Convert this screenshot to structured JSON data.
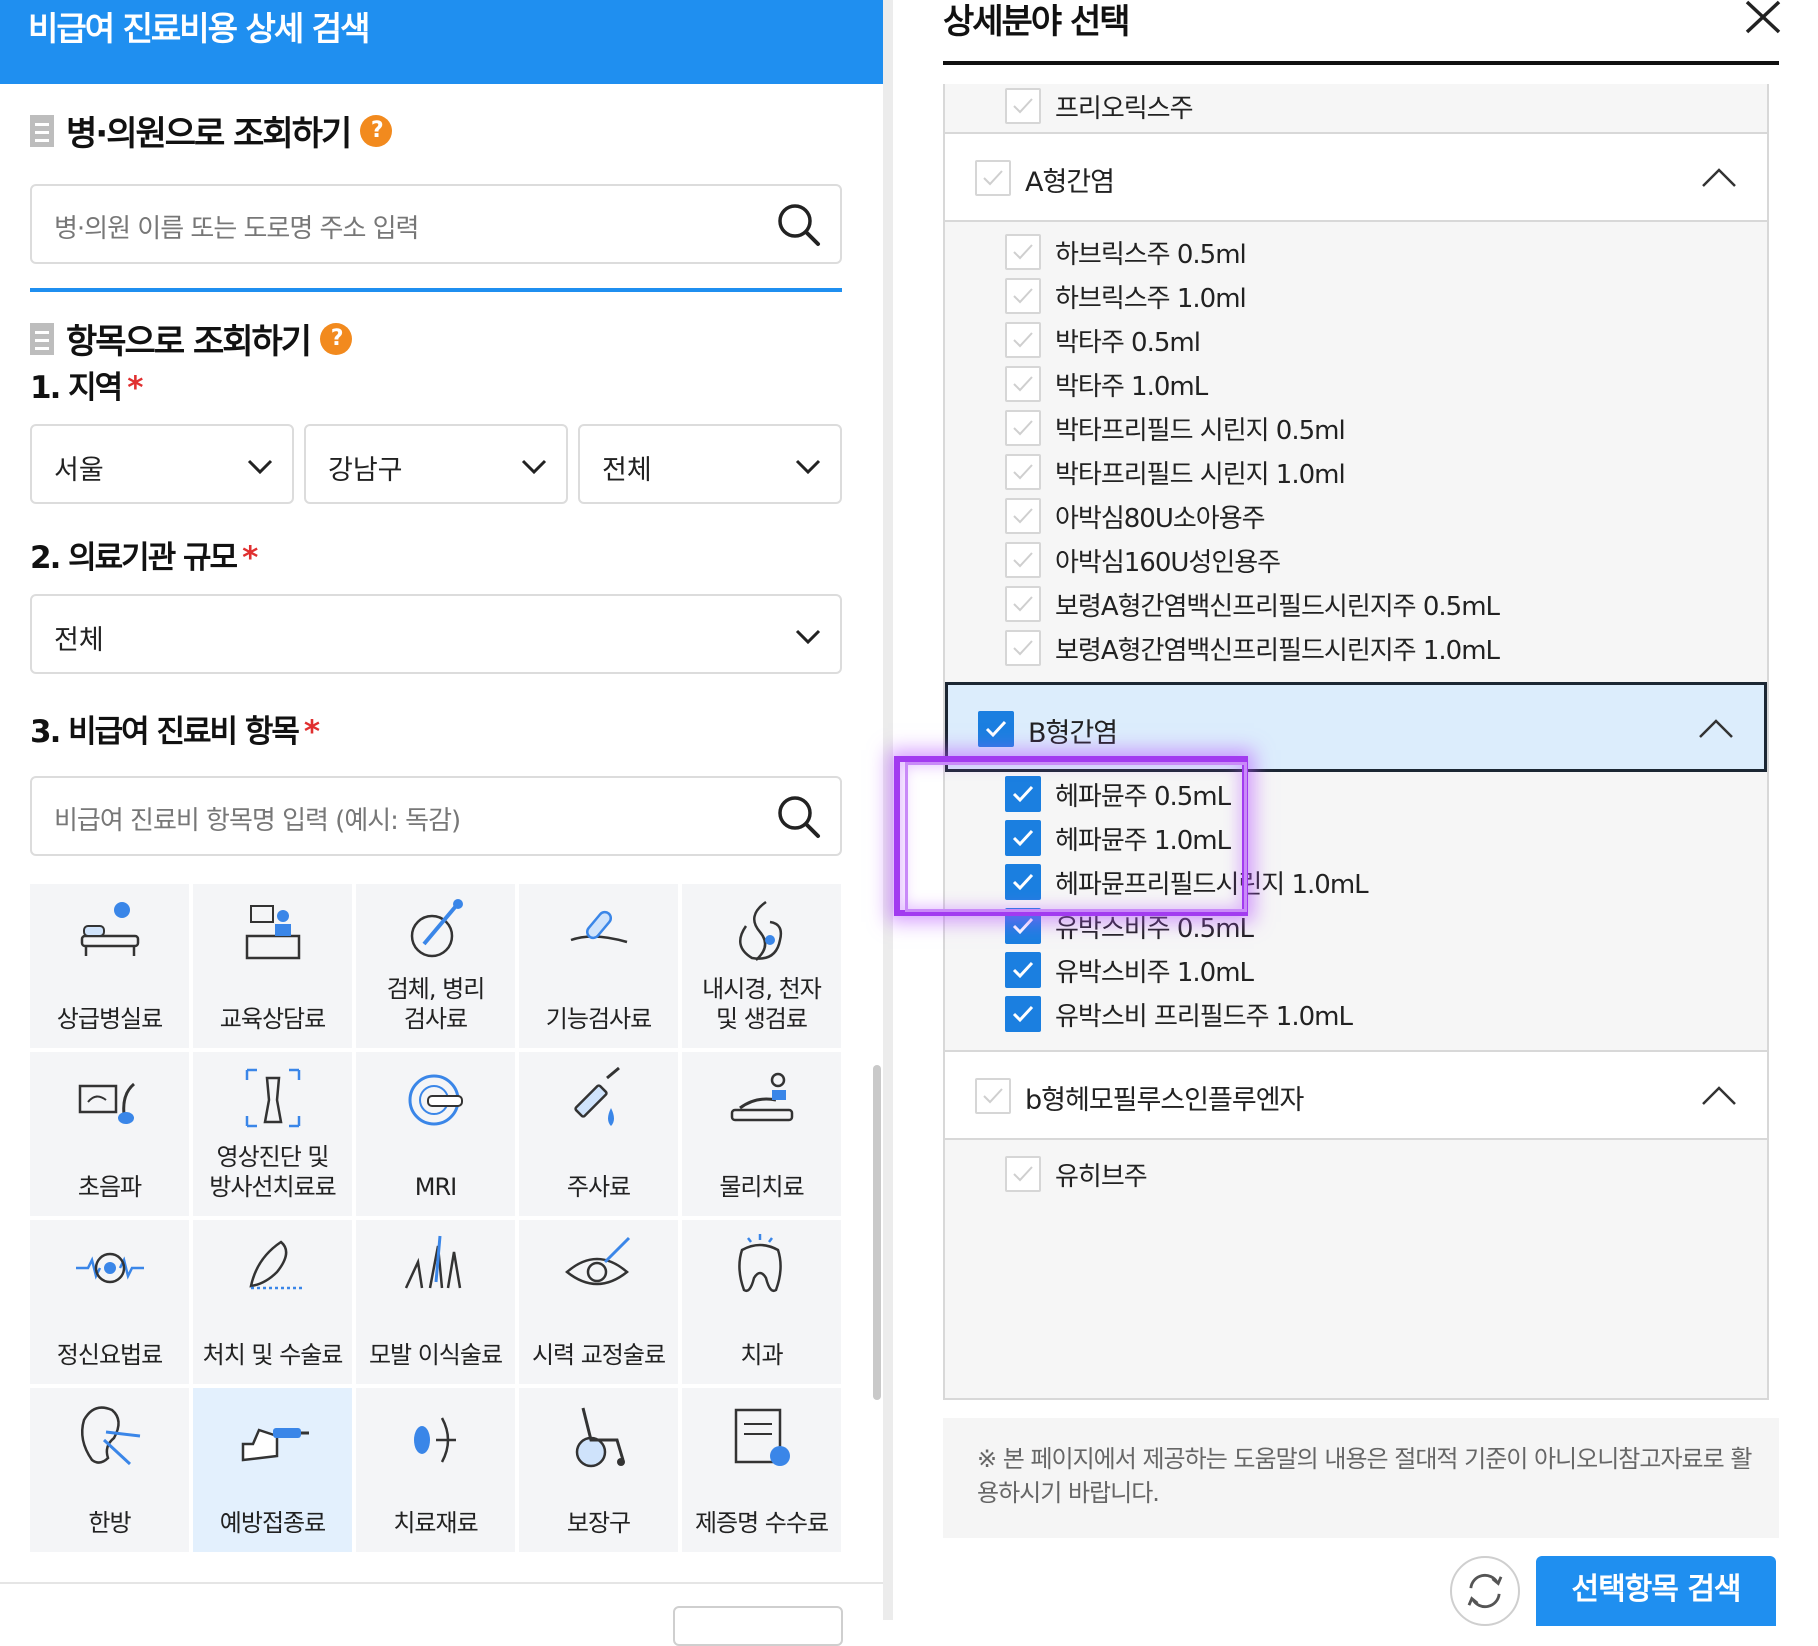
{
  "left": {
    "header_title": "비급여 진료비용 상세 검색",
    "hospital_section": {
      "title": "병·의원으로 조회하기",
      "search_placeholder": "병·의원 이름 또는 도로명 주소 입력"
    },
    "item_section": {
      "title": "항목으로 조회하기",
      "region_label": "1. 지역",
      "region_selects": [
        "서울",
        "강남구",
        "전체"
      ],
      "scale_label": "2. 의료기관 규모",
      "scale_select": "전체",
      "item_label": "3. 비급여 진료비 항목",
      "item_placeholder": "비급여 진료비 항목명 입력 (예시: 독감)",
      "required_mark": "*",
      "help_mark": "?"
    },
    "categories": [
      {
        "label": "상급병실료",
        "icon": "hospital-bed-icon"
      },
      {
        "label": "교육상담료",
        "icon": "counseling-icon"
      },
      {
        "label": "검체, 병리\n검사료",
        "icon": "lab-test-icon"
      },
      {
        "label": "기능검사료",
        "icon": "function-test-icon"
      },
      {
        "label": "내시경, 천자\n및 생검료",
        "icon": "endoscope-icon"
      },
      {
        "label": "초음파",
        "icon": "ultrasound-icon"
      },
      {
        "label": "영상진단 및\n방사선치료료",
        "icon": "xray-icon"
      },
      {
        "label": "MRI",
        "icon": "mri-icon"
      },
      {
        "label": "주사료",
        "icon": "syringe-icon"
      },
      {
        "label": "물리치료",
        "icon": "physical-therapy-icon"
      },
      {
        "label": "정신요법료",
        "icon": "brain-wave-icon"
      },
      {
        "label": "처치 및 수술료",
        "icon": "surgery-icon"
      },
      {
        "label": "모발 이식술료",
        "icon": "hair-transplant-icon"
      },
      {
        "label": "시력 교정술료",
        "icon": "eye-laser-icon"
      },
      {
        "label": "치과",
        "icon": "tooth-icon"
      },
      {
        "label": "한방",
        "icon": "acupuncture-ear-icon"
      },
      {
        "label": "예방접종료",
        "icon": "vaccination-icon"
      },
      {
        "label": "치료재료",
        "icon": "treatment-material-icon"
      },
      {
        "label": "보장구",
        "icon": "wheelchair-icon"
      },
      {
        "label": "제증명 수수료",
        "icon": "certificate-icon"
      }
    ],
    "active_category_index": 16
  },
  "right": {
    "title": "상세분야 선택",
    "top_item": "프리오릭스주",
    "groups": [
      {
        "label": "A형간염",
        "checked": false,
        "items": [
          {
            "label": "하브릭스주 0.5ml",
            "checked": false
          },
          {
            "label": "하브릭스주 1.0ml",
            "checked": false
          },
          {
            "label": "박타주 0.5ml",
            "checked": false
          },
          {
            "label": "박타주 1.0mL",
            "checked": false
          },
          {
            "label": "박타프리필드 시린지 0.5ml",
            "checked": false
          },
          {
            "label": "박타프리필드 시린지 1.0ml",
            "checked": false
          },
          {
            "label": "아박심80U소아용주",
            "checked": false
          },
          {
            "label": "아박심160U성인용주",
            "checked": false
          },
          {
            "label": "보령A형간염백신프리필드시린지주 0.5mL",
            "checked": false
          },
          {
            "label": "보령A형간염백신프리필드시린지주 1.0mL",
            "checked": false
          }
        ]
      },
      {
        "label": "B형간염",
        "checked": true,
        "items": [
          {
            "label": "헤파뮨주 0.5mL",
            "checked": true
          },
          {
            "label": "헤파뮨주 1.0mL",
            "checked": true
          },
          {
            "label": "헤파뮨프리필드시린지 1.0mL",
            "checked": true
          },
          {
            "label": "유박스비주 0.5mL",
            "checked": true
          },
          {
            "label": "유박스비주 1.0mL",
            "checked": true
          },
          {
            "label": "유박스비 프리필드주 1.0mL",
            "checked": true
          }
        ]
      },
      {
        "label": "b형헤모필루스인플루엔자",
        "checked": false,
        "items": [
          {
            "label": "유히브주",
            "checked": false
          }
        ]
      }
    ],
    "note": "※ 본 페이지에서 제공하는 도움말의 내용은 절대적 기준이 아니오니참고자료로 활용하시기 바랍니다.",
    "search_button": "선택항목 검색"
  },
  "colors": {
    "brand_blue": "#1f8ff0",
    "check_blue": "#1b7fe0",
    "help_orange": "#f28a1e",
    "highlight_purple": "#a23bf0",
    "required_red": "#e03030"
  }
}
